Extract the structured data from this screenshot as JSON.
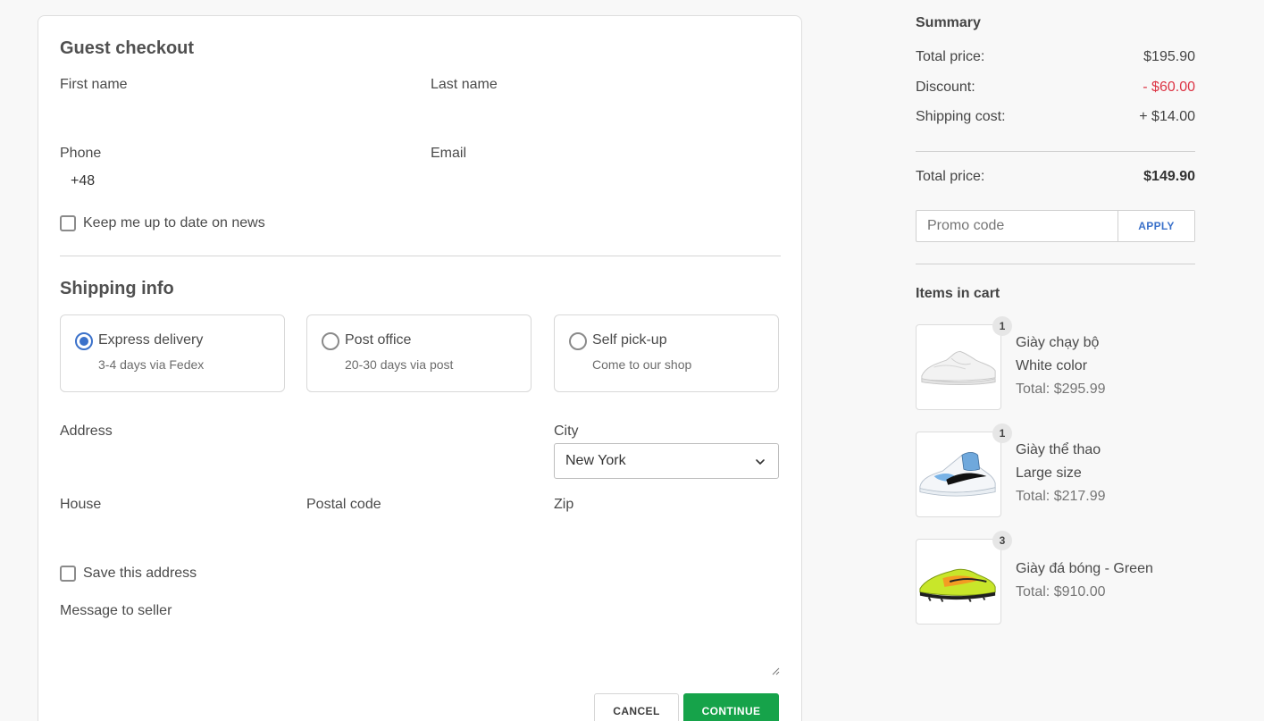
{
  "checkout": {
    "title": "Guest checkout",
    "first_name_label": "First name",
    "last_name_label": "Last name",
    "phone_label": "Phone",
    "phone_prefix": "+48",
    "email_label": "Email",
    "news_checkbox_label": "Keep me up to date on news",
    "shipping_title": "Shipping info",
    "shipping_options": [
      {
        "title": "Express delivery",
        "sub": "3-4 days via Fedex",
        "selected": true
      },
      {
        "title": "Post office",
        "sub": "20-30 days via post",
        "selected": false
      },
      {
        "title": "Self pick-up",
        "sub": "Come to our shop",
        "selected": false
      }
    ],
    "address_label": "Address",
    "city_label": "City",
    "city_value": "New York",
    "house_label": "House",
    "postal_code_label": "Postal code",
    "zip_label": "Zip",
    "save_address_label": "Save this address",
    "message_label": "Message to seller",
    "cancel_label": "CANCEL",
    "continue_label": "CONTINUE"
  },
  "summary": {
    "title": "Summary",
    "rows": [
      {
        "label": "Total price:",
        "value": "$195.90"
      },
      {
        "label": "Discount:",
        "value": "- $60.00"
      },
      {
        "label": "Shipping cost:",
        "value": "+ $14.00"
      }
    ],
    "total_label": "Total price:",
    "total_value": "$149.90",
    "promo_placeholder": "Promo code",
    "apply_label": "APPLY",
    "items_title": "Items in cart",
    "items": [
      {
        "qty": "1",
        "name": "Giày chạy bộ",
        "variant": "White color",
        "total": "Total: $295.99",
        "image": "white-sneaker"
      },
      {
        "qty": "1",
        "name": "Giày thể thao",
        "variant": "Large size",
        "total": "Total: $217.99",
        "image": "blue-high-top-sneaker"
      },
      {
        "qty": "3",
        "name": "Giày đá bóng - Green",
        "total": "Total: $910.00",
        "image": "green-football-boot"
      }
    ]
  },
  "colors": {
    "accent": "#3b71ca",
    "primary_button": "#16a34a",
    "discount": "#dc3545"
  }
}
